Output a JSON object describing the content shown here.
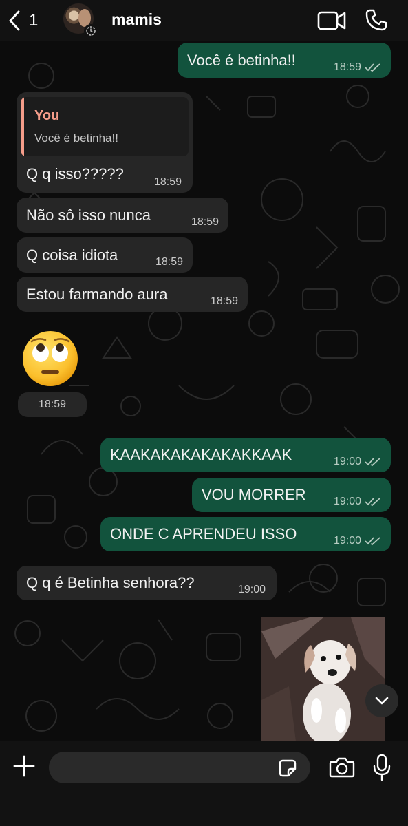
{
  "header": {
    "back_count": "1",
    "contact_name": "mamis"
  },
  "messages": [
    {
      "id": "m1",
      "direction": "outgoing",
      "text": "Você é betinha!!",
      "time": "18:59",
      "status": "read"
    },
    {
      "id": "m2",
      "direction": "incoming",
      "reply_to": {
        "author": "You",
        "text": "Você é betinha!!"
      },
      "text": "Q q isso?????",
      "time": "18:59"
    },
    {
      "id": "m3",
      "direction": "incoming",
      "text": "Não sô isso nunca",
      "time": "18:59"
    },
    {
      "id": "m4",
      "direction": "incoming",
      "text": "Q coisa idiota",
      "time": "18:59"
    },
    {
      "id": "m5",
      "direction": "incoming",
      "text": "Estou farmando aura",
      "time": "18:59"
    },
    {
      "id": "m6",
      "direction": "incoming",
      "type": "emoji",
      "emoji": "🙄",
      "time": "18:59"
    },
    {
      "id": "m7",
      "direction": "outgoing",
      "text": "KAAKAKAKAKAKAKKAAK",
      "time": "19:00",
      "status": "read"
    },
    {
      "id": "m8",
      "direction": "outgoing",
      "text": "VOU MORRER",
      "time": "19:00",
      "status": "read"
    },
    {
      "id": "m9",
      "direction": "outgoing",
      "text": "ONDE C APRENDEU ISSO",
      "time": "19:00",
      "status": "read"
    },
    {
      "id": "m10",
      "direction": "incoming",
      "text": "Q q é Betinha senhora??",
      "time": "19:00"
    },
    {
      "id": "m11",
      "direction": "incoming",
      "type": "sticker",
      "description_icon": "dog-sticker"
    }
  ],
  "composer": {
    "placeholder": ""
  },
  "icons": {
    "back": "chevron-left-icon",
    "video": "video-camera-icon",
    "call": "phone-icon",
    "timer": "disappearing-timer-icon",
    "ticks": "double-check-icon",
    "scroll": "chevron-down-icon",
    "plus": "plus-icon",
    "sticker": "sticker-icon",
    "camera": "camera-icon",
    "mic": "microphone-icon"
  },
  "colors": {
    "incoming_bubble": "#262626",
    "outgoing_bubble": "#12533d",
    "reply_accent": "#f59d8a",
    "background": "#0c0c0c"
  }
}
